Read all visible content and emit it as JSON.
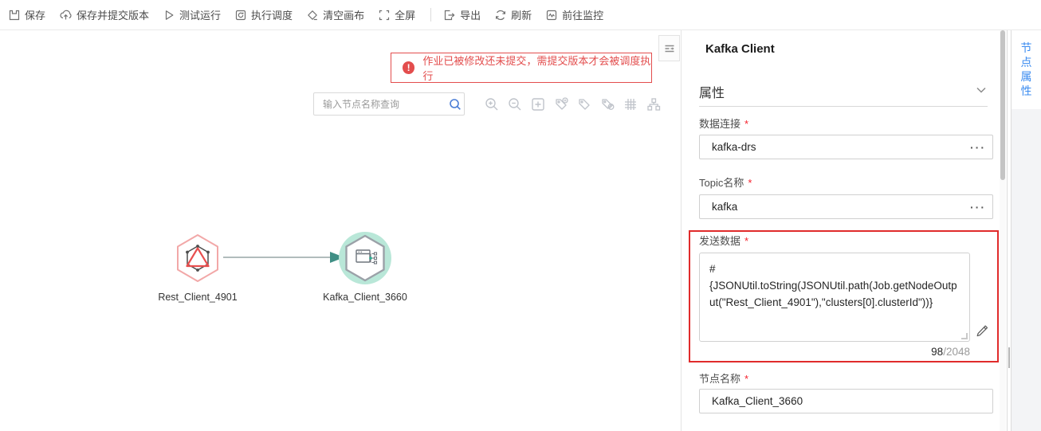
{
  "toolbar": {
    "items": [
      {
        "label": "保存",
        "icon": "save-icon"
      },
      {
        "label": "保存并提交版本",
        "icon": "submit-version-icon"
      },
      {
        "label": "测试运行",
        "icon": "test-run-icon"
      },
      {
        "label": "执行调度",
        "icon": "schedule-icon"
      },
      {
        "label": "清空画布",
        "icon": "clear-canvas-icon"
      },
      {
        "label": "全屏",
        "icon": "fullscreen-icon"
      },
      {
        "label": "导出",
        "icon": "export-icon"
      },
      {
        "label": "刷新",
        "icon": "refresh-icon"
      },
      {
        "label": "前往监控",
        "icon": "monitor-icon"
      }
    ]
  },
  "canvas": {
    "warning": {
      "text": "作业已被修改还未提交，需提交版本才会被调度执行"
    },
    "search": {
      "placeholder": "输入节点名称查询",
      "icon": "search-icon"
    },
    "tools": [
      "zoom-in-icon",
      "zoom-out-icon",
      "fit-view-icon",
      "add-tag-icon",
      "tag-icon",
      "hide-tag-icon",
      "grid-icon",
      "auto-layout-icon"
    ],
    "nodes": [
      {
        "label": "Rest_Client_4901",
        "type": "rest-client"
      },
      {
        "label": "Kafka_Client_3660",
        "type": "kafka-client"
      }
    ]
  },
  "panel": {
    "title": "Kafka Client",
    "section": "属性",
    "fields": {
      "connection": {
        "label": "数据连接",
        "required": "*",
        "value": "kafka-drs"
      },
      "topic": {
        "label": "Topic名称",
        "required": "*",
        "value": "kafka"
      },
      "payload": {
        "label": "发送数据",
        "required": "*",
        "value": "#\n{JSONUtil.toString(JSONUtil.path(Job.getNodeOutput(\"Rest_Client_4901\"),\"clusters[0].clusterId\"))}",
        "count": "98",
        "max": "/2048"
      },
      "nodeName": {
        "label": "节点名称",
        "required": "*",
        "value": "Kafka_Client_3660"
      }
    }
  },
  "rightTab": {
    "label": "节点属性"
  },
  "colors": {
    "accent_blue": "#3c8cf0",
    "warning_red": "#e34d4d",
    "highlight_red": "#e02b2b",
    "kafka_node_mint": "#b9e7d8",
    "rest_node_pink": "#f2a8a8",
    "arrow_teal": "#3f8f85"
  }
}
